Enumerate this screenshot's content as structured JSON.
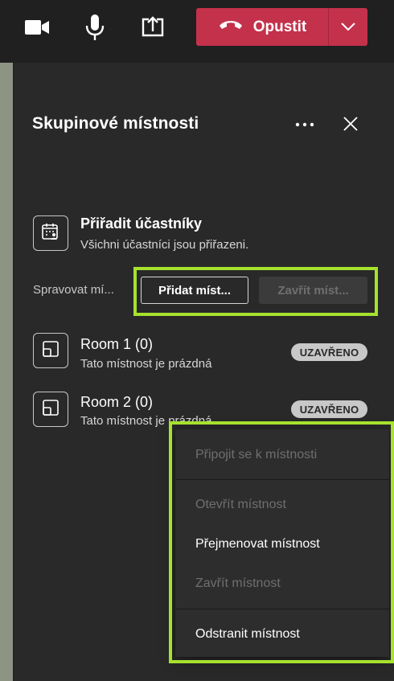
{
  "toolbar": {
    "camera_icon": "camera-icon",
    "mic_icon": "microphone-icon",
    "share_icon": "share-screen-icon",
    "leave_label": "Opustit",
    "leave_color": "#c4314b"
  },
  "panel": {
    "title": "Skupinové místnosti",
    "assign": {
      "title": "Přiřadit účastníky",
      "subtitle": "Všichni účastníci jsou přiřazeni."
    },
    "manage": {
      "label": "Spravovat mí...",
      "add_button": "Přidat míst...",
      "close_button": "Zavřít míst..."
    },
    "rooms": [
      {
        "name": "Room 1 (0)",
        "subtitle": "Tato místnost je prázdná",
        "badge": "UZAVŘENO"
      },
      {
        "name": "Room 2 (0)",
        "subtitle": "Tato místnost je prázdná",
        "badge": "UZAVŘENO"
      }
    ]
  },
  "context_menu": {
    "items": [
      {
        "label": "Připojit se k místnosti",
        "enabled": false
      },
      {
        "label": "Otevřít místnost",
        "enabled": false
      },
      {
        "label": "Přejmenovat místnost",
        "enabled": true
      },
      {
        "label": "Zavřít místnost",
        "enabled": false
      },
      {
        "label": "Odstranit místnost",
        "enabled": true
      }
    ]
  },
  "colors": {
    "highlight": "#a6e22e",
    "panel_bg": "#292929",
    "topbar_bg": "#202020"
  }
}
